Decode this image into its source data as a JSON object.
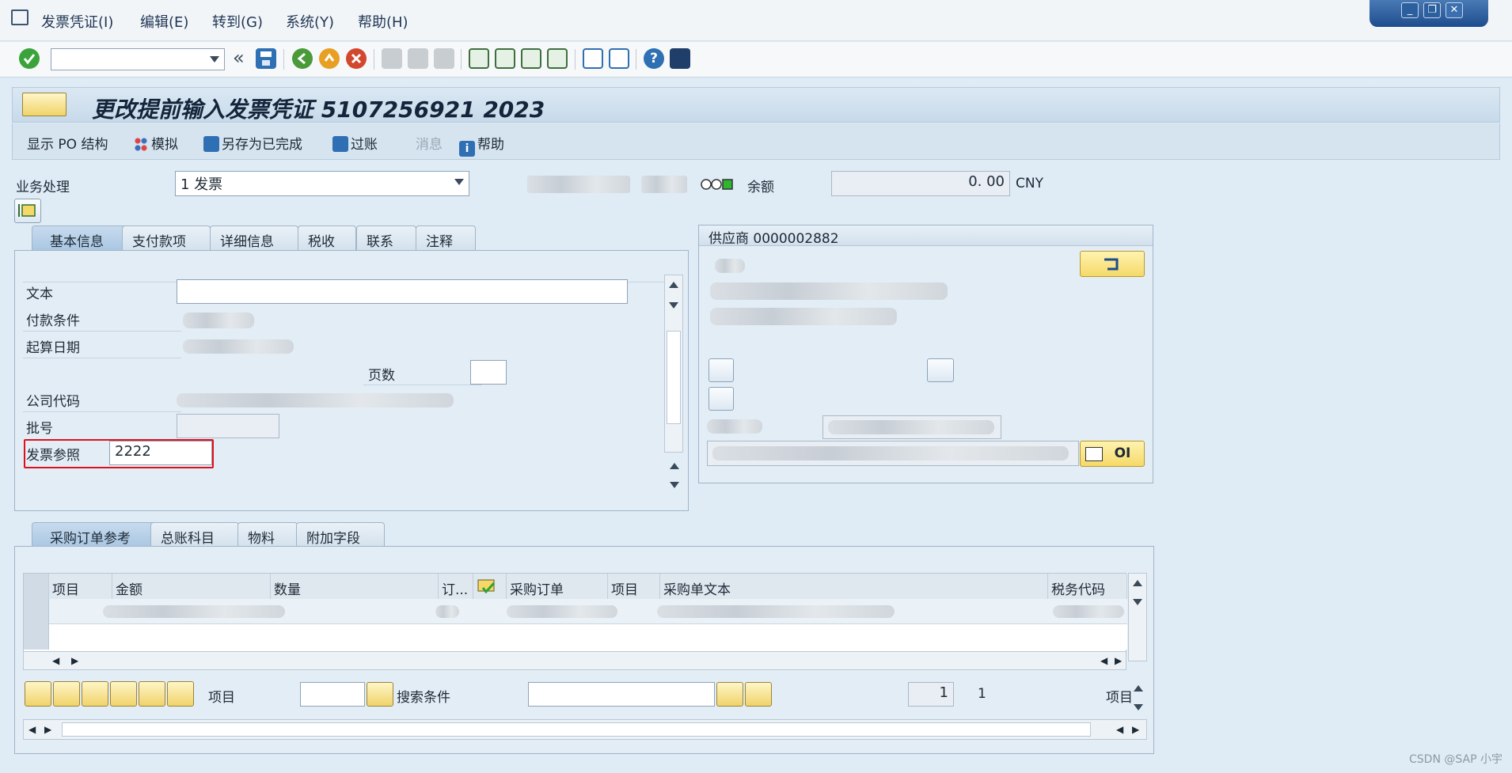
{
  "menu": [
    {
      "label": "发票凭证(I)"
    },
    {
      "label": "编辑(E)"
    },
    {
      "label": "转到(G)"
    },
    {
      "label": "系统(Y)"
    },
    {
      "label": "帮助(H)"
    }
  ],
  "window_controls": {
    "minimize": "_",
    "restore": "❐",
    "close": "✕"
  },
  "toolbar": {
    "command_field_value": "",
    "expand_symbol": "«"
  },
  "title": "更改提前输入发票凭证 5107256921 2023",
  "app_toolbar": {
    "po_structure": "显示 PO 结构",
    "simulate": "模拟",
    "save_complete": "另存为已完成",
    "post": "过账",
    "messages": "消息",
    "help": "帮助"
  },
  "header": {
    "transaction_label": "业务处理",
    "transaction_value": "1 发票",
    "balance_label": "余额",
    "balance_value": "0. 00",
    "currency": "CNY"
  },
  "tabs_top": [
    {
      "label": "基本信息",
      "active": true
    },
    {
      "label": "支付款项"
    },
    {
      "label": "详细信息"
    },
    {
      "label": "税收"
    },
    {
      "label": "联系"
    },
    {
      "label": "注释"
    }
  ],
  "basic_info": {
    "text_label": "文本",
    "text_value": "",
    "payment_terms_label": "付款条件",
    "baseline_date_label": "起算日期",
    "pages_label": "页数",
    "pages_value": "",
    "company_code_label": "公司代码",
    "batch_label": "批号",
    "batch_value": "",
    "invoice_ref_label": "发票参照",
    "invoice_ref_value": "2222"
  },
  "vendor": {
    "label": "供应商",
    "number": "0000002882",
    "oi_button": "OI"
  },
  "tabs_bottom": [
    {
      "label": "采购订单参考",
      "active": true
    },
    {
      "label": "总账科目"
    },
    {
      "label": "物料"
    },
    {
      "label": "附加字段"
    }
  ],
  "table": {
    "columns": [
      "项目",
      "金额",
      "数量",
      "订...",
      "",
      "采购订单",
      "项目",
      "采购单文本",
      "税务代码"
    ]
  },
  "table_footer": {
    "item_label": "项目",
    "item_value": "",
    "search_label": "搜索条件",
    "search_value": "",
    "page_current": "1",
    "page_total": "1",
    "item_right_label": "项目"
  },
  "watermark": "CSDN @SAP 小宇",
  "colors": {
    "accent": "#1f3654",
    "highlight": "#e0101a",
    "ok_green": "#3aa43a"
  }
}
